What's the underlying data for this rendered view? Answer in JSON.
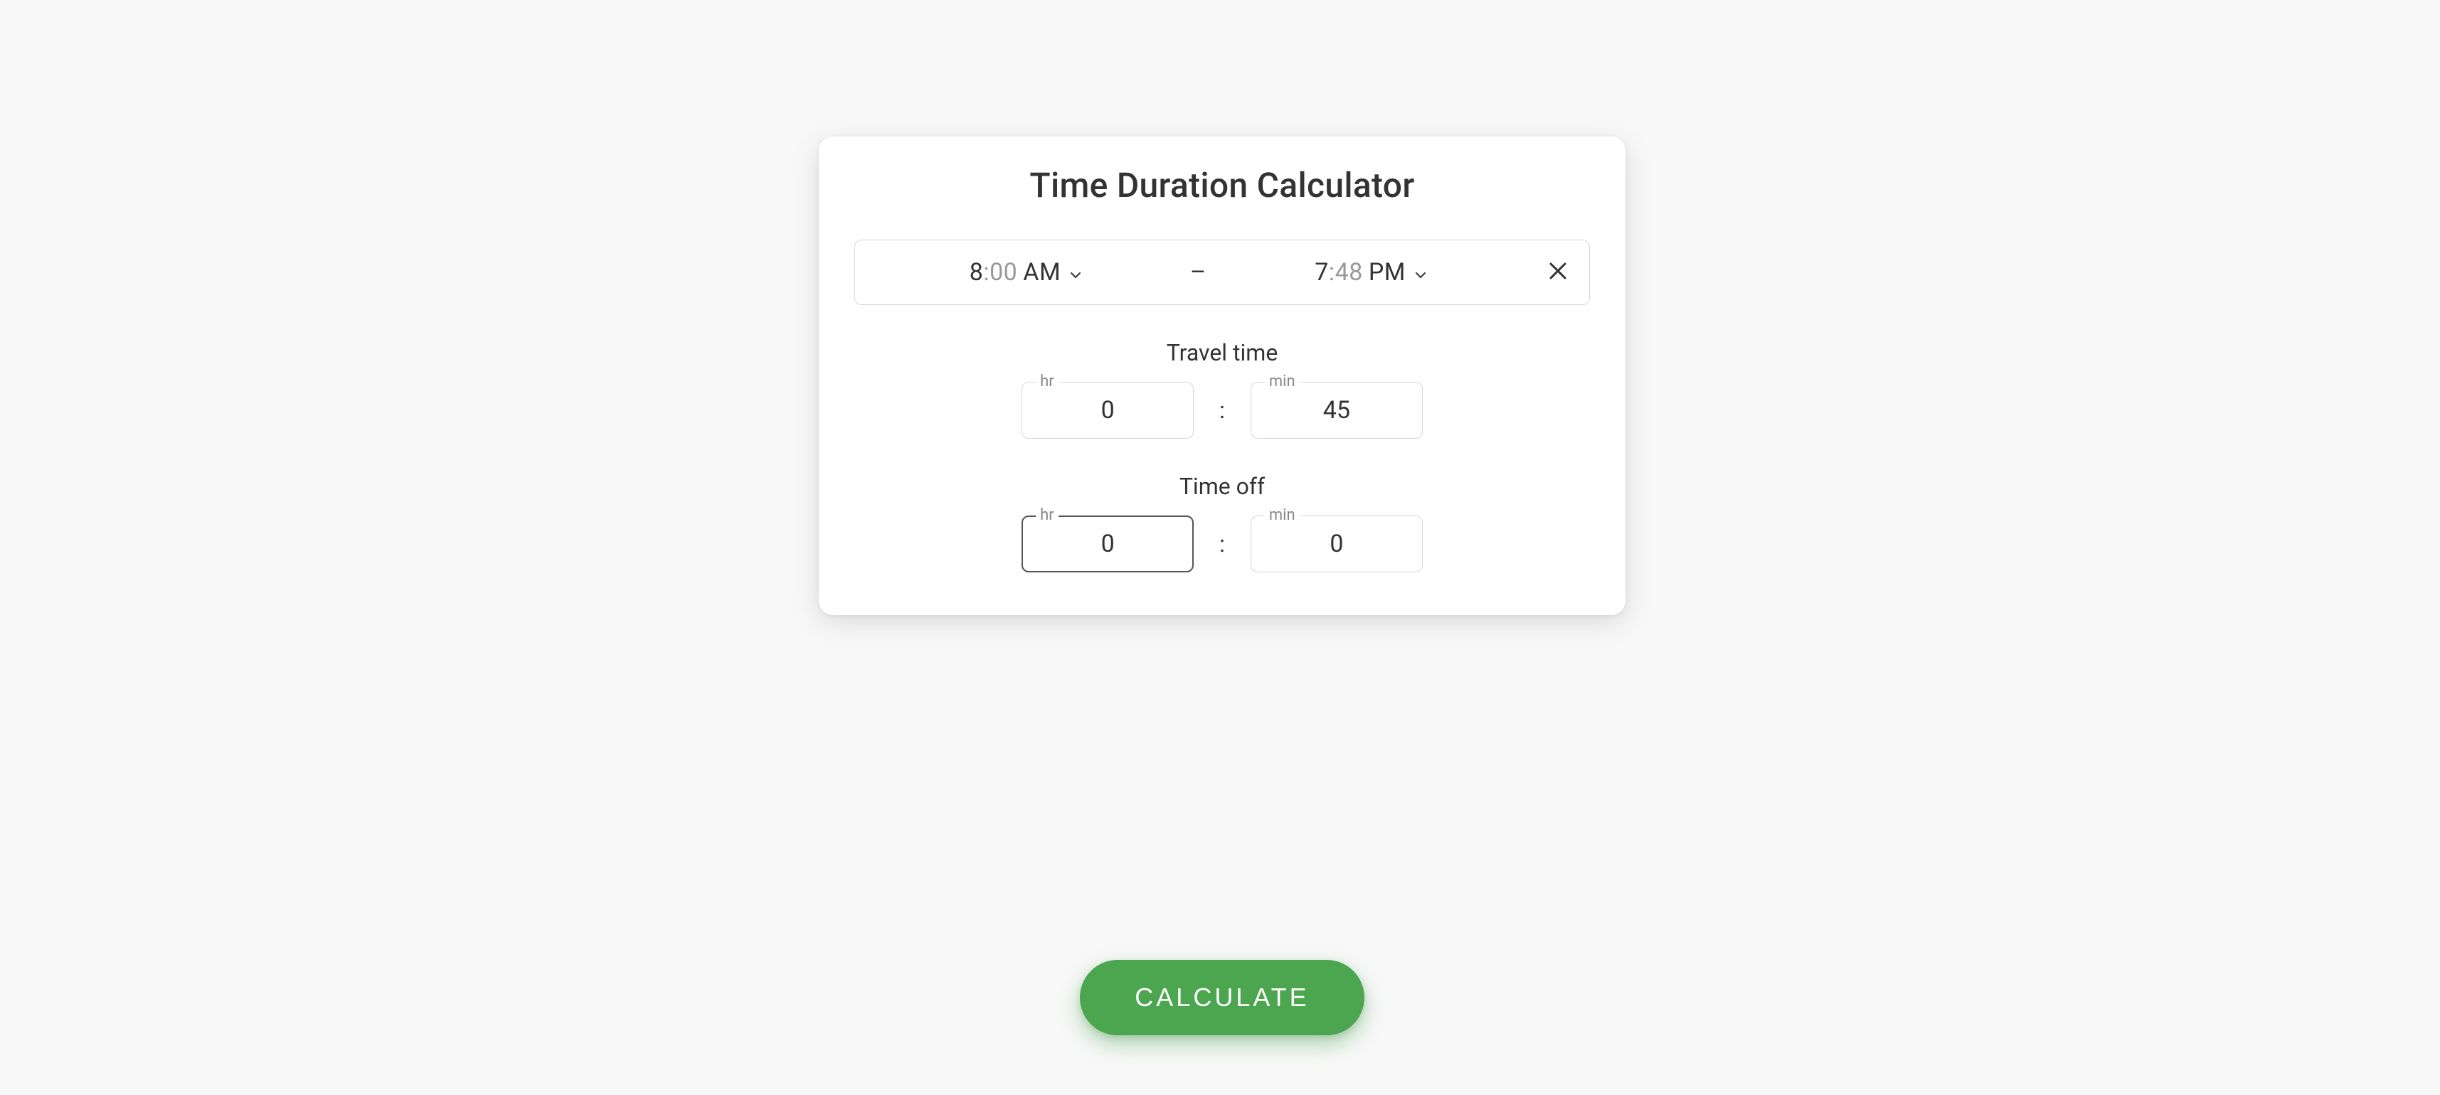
{
  "title": "Time Duration Calculator",
  "time_range": {
    "start": {
      "hour": "8",
      "minute": "00",
      "ampm": "AM"
    },
    "separator": "–",
    "end": {
      "hour": "7",
      "minute": "48",
      "ampm": "PM"
    }
  },
  "colon_text": ":",
  "travel_time": {
    "label": "Travel time",
    "hr_label": "hr",
    "min_label": "min",
    "hr_value": "0",
    "min_value": "45"
  },
  "time_off": {
    "label": "Time off",
    "hr_label": "hr",
    "min_label": "min",
    "hr_value": "0",
    "min_value": "0"
  },
  "calculate_label": "CALCULATE"
}
